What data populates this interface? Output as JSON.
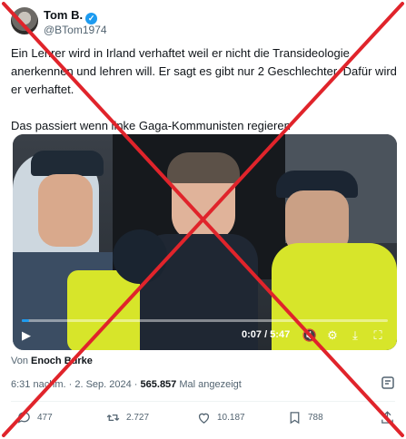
{
  "author": {
    "name": "Tom B.",
    "handle": "@BTom1974",
    "verified_icon": "verified-badge-icon"
  },
  "tweet": {
    "paragraph1": "Ein Lehrer wird in Irland verhaftet weil er nicht die Transideologie anerkennen und lehren will. Er sagt es gibt nur 2 Geschlechter. Dafür wird er verhaftet.",
    "paragraph2": "Das passiert wenn linke Gaga-Kommunisten regieren"
  },
  "video": {
    "time": "0:07 / 5:47",
    "progress": 0.02,
    "controls": [
      "play-icon",
      "volume-muted-icon",
      "settings-icon",
      "minimize-icon",
      "fullscreen-icon"
    ]
  },
  "source": {
    "prefix": "Von",
    "name": "Enoch Burke"
  },
  "meta": {
    "time": "6:31 nachm.",
    "separator": "·",
    "date": "2. Sep. 2024",
    "views_count": "565.857",
    "views_label": "Mal angezeigt"
  },
  "actions": {
    "replies": "477",
    "reposts": "2.727",
    "likes": "10.187",
    "bookmarks": "788"
  },
  "colors": {
    "accent": "#1d9bf0",
    "cross": "#e0242b",
    "muted": "#536471"
  }
}
